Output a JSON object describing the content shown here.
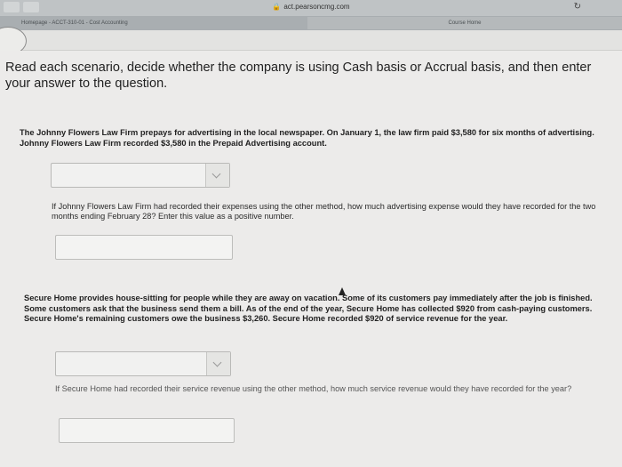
{
  "browser": {
    "url": "act.pearsoncmg.com",
    "tabs": [
      {
        "label": "Homepage - ACCT-310-01 - Cost Accounting"
      },
      {
        "label": "Course Home"
      }
    ]
  },
  "instructions": "Read each scenario, decide whether the company is using Cash basis or Accrual basis, and then enter your answer to the question.",
  "scenarios": [
    {
      "text": "The Johnny Flowers Law Firm prepays for advertising in the local newspaper. On January 1, the law firm paid $3,580 for six months of advertising. Johnny Flowers Law Firm recorded $3,580 in the Prepaid Advertising account.",
      "basis_select_value": "",
      "question": "If Johnny Flowers Law Firm had recorded their expenses using the other method, how much advertising expense would they have recorded for the two months ending February 28? Enter this value as a positive number.",
      "answer_value": ""
    },
    {
      "text": "Secure Home provides house-sitting for people while they are away on vacation. Some of its customers pay immediately after the job is finished. Some customers ask that the business send them a bill. As of the end of the year, Secure Home has collected $920 from cash-paying customers. Secure Home's remaining customers owe the business $3,260. Secure Home recorded $920 of service revenue for the year.",
      "basis_select_value": "",
      "question": "If Secure Home had recorded their service revenue using the other method, how much service revenue would they have recorded for the year?",
      "answer_value": ""
    }
  ]
}
